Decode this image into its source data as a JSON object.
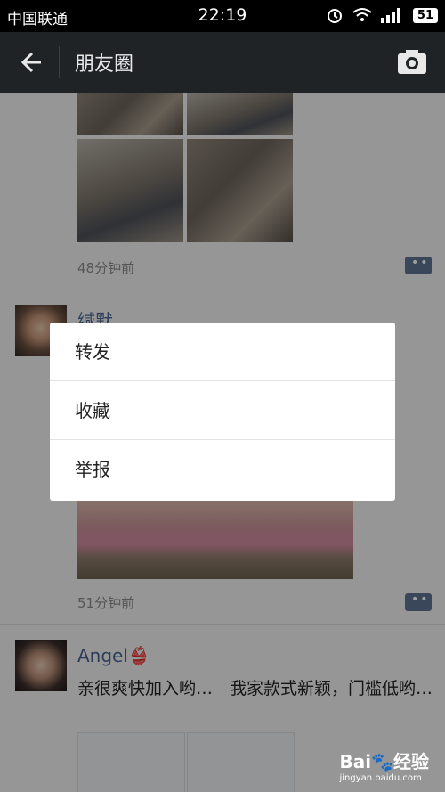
{
  "status_bar": {
    "carrier": "中国联通",
    "time": "22:19",
    "battery": "51"
  },
  "nav": {
    "title": "朋友圈"
  },
  "feed": {
    "post1": {
      "timestamp": "48分钟前"
    },
    "post2": {
      "username": "缄默",
      "timestamp": "51分钟前"
    },
    "post3": {
      "username": "Angel👙",
      "text": "亲很爽快加入哟…　我家款式新颖，门槛低哟…"
    }
  },
  "context_menu": {
    "items": [
      "转发",
      "收藏",
      "举报"
    ]
  },
  "watermark": {
    "brand": "Bai🐾经验",
    "url": "jingyan.baidu.com"
  },
  "colors": {
    "navbar": "#1f2326",
    "username": "#4a6390",
    "comment_button": "#5e7290"
  }
}
